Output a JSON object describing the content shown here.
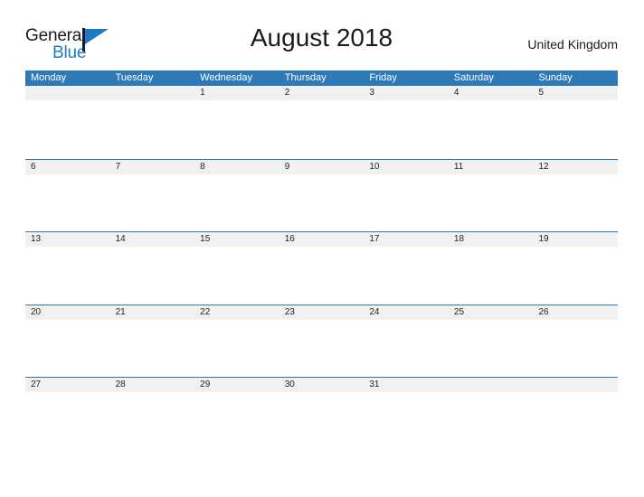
{
  "brand": {
    "name_part1": "General",
    "name_part2": "Blue",
    "flag_icon": "flag-icon"
  },
  "header": {
    "title": "August 2018",
    "country": "United Kingdom"
  },
  "colors": {
    "header_blue": "#2e7ab8",
    "band_gray": "#f1f1f1",
    "brand_blue": "#1f7ac4",
    "text_dark": "#1a1a1a"
  },
  "calendar": {
    "weekdays": [
      "Monday",
      "Tuesday",
      "Wednesday",
      "Thursday",
      "Friday",
      "Saturday",
      "Sunday"
    ],
    "weeks": [
      [
        "",
        "",
        "1",
        "2",
        "3",
        "4",
        "5"
      ],
      [
        "6",
        "7",
        "8",
        "9",
        "10",
        "11",
        "12"
      ],
      [
        "13",
        "14",
        "15",
        "16",
        "17",
        "18",
        "19"
      ],
      [
        "20",
        "21",
        "22",
        "23",
        "24",
        "25",
        "26"
      ],
      [
        "27",
        "28",
        "29",
        "30",
        "31",
        "",
        ""
      ]
    ]
  }
}
